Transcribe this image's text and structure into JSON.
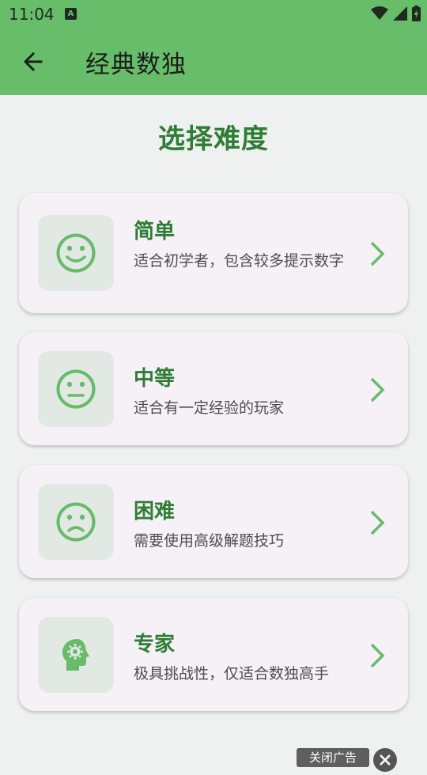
{
  "status_bar": {
    "time": "11:04",
    "a_badge": "A"
  },
  "app_bar": {
    "title": "经典数独"
  },
  "page": {
    "heading": "选择难度"
  },
  "difficulties": [
    {
      "title": "简单",
      "description": "适合初学者，包含较多提示数字",
      "icon": "smile-face-icon"
    },
    {
      "title": "中等",
      "description": "适合有一定经验的玩家",
      "icon": "neutral-face-icon"
    },
    {
      "title": "困难",
      "description": "需要使用高级解题技巧",
      "icon": "sad-face-icon"
    },
    {
      "title": "专家",
      "description": "极具挑战性，仅适合数独高手",
      "icon": "head-gear-icon"
    }
  ],
  "ad": {
    "close_label": "关闭广告"
  },
  "colors": {
    "primary": "#68bd6b",
    "accent_text": "#2f7d34",
    "card_bg": "#f6f0f7",
    "icon_box_bg": "#e2e8e2"
  }
}
